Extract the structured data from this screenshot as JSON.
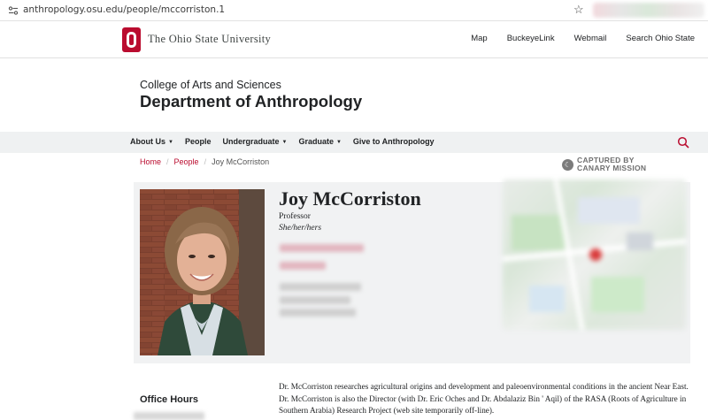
{
  "browser": {
    "url": "anthropology.osu.edu/people/mccorriston.1"
  },
  "osu_header": {
    "university_name": "The Ohio State University",
    "links": [
      "Map",
      "BuckeyeLink",
      "Webmail",
      "Search Ohio State"
    ]
  },
  "department": {
    "college": "College of Arts and Sciences",
    "name": "Department of Anthropology"
  },
  "nav": {
    "items": [
      {
        "label": "About Us",
        "dropdown": true
      },
      {
        "label": "People",
        "dropdown": false
      },
      {
        "label": "Undergraduate",
        "dropdown": true
      },
      {
        "label": "Graduate",
        "dropdown": true
      },
      {
        "label": "Give to Anthropology",
        "dropdown": false
      }
    ]
  },
  "breadcrumb": {
    "items": [
      "Home",
      "People"
    ],
    "current": "Joy McCorriston"
  },
  "captured_badge": {
    "line1": "CAPTURED BY",
    "line2": "CANARY MISSION"
  },
  "profile": {
    "name": "Joy McCorriston",
    "title": "Professor",
    "pronouns": "She/her/hers"
  },
  "sidebar": {
    "office_hours_label": "Office Hours"
  },
  "bio": {
    "text": "Dr. McCorriston researches agricultural origins and development and paleoenvironmental conditions in the ancient Near East. Dr. McCorriston is also the Director (with Dr. Eric Oches and Dr. Abdalaziz Bin ' Aqil) of the RASA (Roots of Agriculture in Southern Arabia) Research Project (web site temporarily off-line)."
  },
  "colors": {
    "osu_scarlet": "#ba0c2f",
    "nav_bg": "#eff1f2",
    "card_bg": "#f1f2f3"
  }
}
